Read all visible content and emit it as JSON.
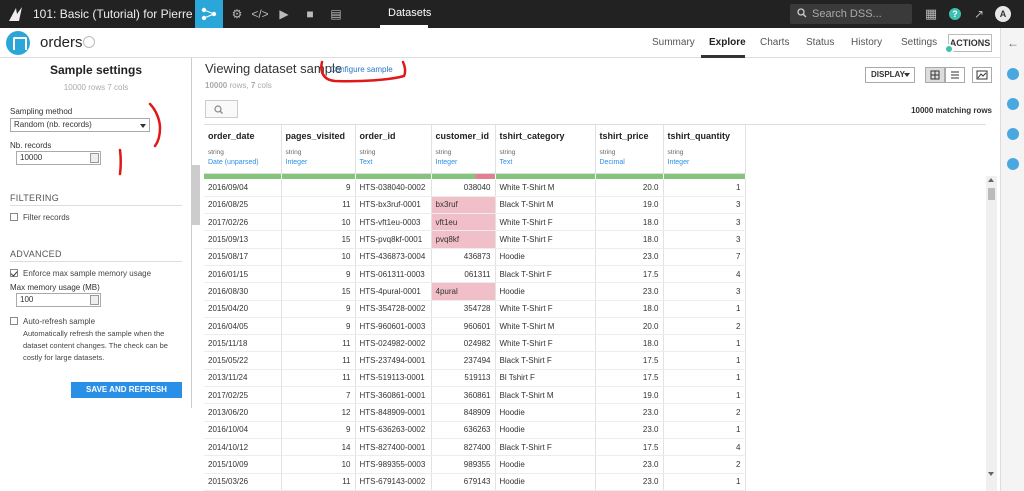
{
  "topbar": {
    "project": "101: Basic (Tutorial) for Pierre Ro...",
    "section": "Datasets",
    "search_placeholder": "Search DSS...",
    "help": "?",
    "avatar": "A"
  },
  "header": {
    "dataset_name": "orders",
    "tabs": [
      "Summary",
      "Explore",
      "Charts",
      "Status",
      "History",
      "Settings"
    ],
    "active_tab": "Explore",
    "actions_label": "ACTIONS"
  },
  "sample_settings": {
    "title": "Sample settings",
    "subtitle": "10000 rows 7 cols",
    "sampling_method_label": "Sampling method",
    "sampling_method_value": "Random (nb. records)",
    "nb_records_label": "Nb. records",
    "nb_records_value": "10000",
    "filtering_title": "FILTERING",
    "filter_records_label": "Filter records",
    "advanced_title": "ADVANCED",
    "enforce_label": "Enforce max sample memory usage",
    "max_memory_label": "Max memory usage (MB)",
    "max_memory_value": "100",
    "auto_refresh_label": "Auto-refresh sample",
    "auto_refresh_desc": "Automatically refresh the sample when the dataset content changes. The check can be costly for large datasets.",
    "save_button": "SAVE AND REFRESH SAMPLE"
  },
  "main": {
    "title": "Viewing dataset sample",
    "configure_link": "Configure sample",
    "rows_label": "10000",
    "rows_word": "rows,",
    "cols_label": "7",
    "cols_word": "cols",
    "display_label": "DISPLAY",
    "matching_rows": "10000 matching rows"
  },
  "table": {
    "columns": [
      {
        "name": "order_date",
        "storage": "string",
        "meaning": "Date (unparsed)"
      },
      {
        "name": "pages_visited",
        "storage": "string",
        "meaning": "Integer"
      },
      {
        "name": "order_id",
        "storage": "string",
        "meaning": "Text"
      },
      {
        "name": "customer_id",
        "storage": "string",
        "meaning": "Integer"
      },
      {
        "name": "tshirt_category",
        "storage": "string",
        "meaning": "Text"
      },
      {
        "name": "tshirt_price",
        "storage": "string",
        "meaning": "Decimal"
      },
      {
        "name": "tshirt_quantity",
        "storage": "string",
        "meaning": "Integer"
      }
    ],
    "rows": [
      [
        "2016/09/04",
        "9",
        "HTS-038040-0002",
        "038040",
        "White T-Shirt M",
        "20.0",
        "1"
      ],
      [
        "2016/08/25",
        "11",
        "HTS-bx3ruf-0001",
        "bx3ruf",
        "Black T-Shirt M",
        "19.0",
        "3"
      ],
      [
        "2017/02/26",
        "10",
        "HTS-vft1eu-0003",
        "vft1eu",
        "White T-Shirt F",
        "18.0",
        "3"
      ],
      [
        "2015/09/13",
        "15",
        "HTS-pvq8kf-0001",
        "pvq8kf",
        "White T-Shirt F",
        "18.0",
        "3"
      ],
      [
        "2015/08/17",
        "10",
        "HTS-436873-0004",
        "436873",
        "Hoodie",
        "23.0",
        "7"
      ],
      [
        "2016/01/15",
        "9",
        "HTS-061311-0003",
        "061311",
        "Black T-Shirt F",
        "17.5",
        "4"
      ],
      [
        "2016/08/30",
        "15",
        "HTS-4pural-0001",
        "4pural",
        "Hoodie",
        "23.0",
        "3"
      ],
      [
        "2015/04/20",
        "9",
        "HTS-354728-0002",
        "354728",
        "White T-Shirt F",
        "18.0",
        "1"
      ],
      [
        "2016/04/05",
        "9",
        "HTS-960601-0003",
        "960601",
        "White T-Shirt M",
        "20.0",
        "2"
      ],
      [
        "2015/11/18",
        "11",
        "HTS-024982-0002",
        "024982",
        "White T-Shirt F",
        "18.0",
        "1"
      ],
      [
        "2015/05/22",
        "11",
        "HTS-237494-0001",
        "237494",
        "Black T-Shirt F",
        "17.5",
        "1"
      ],
      [
        "2013/11/24",
        "11",
        "HTS-519113-0001",
        "519113",
        "Bl Tshirt F",
        "17.5",
        "1"
      ],
      [
        "2017/02/25",
        "7",
        "HTS-360861-0001",
        "360861",
        "Black T-Shirt M",
        "19.0",
        "1"
      ],
      [
        "2013/06/20",
        "12",
        "HTS-848909-0001",
        "848909",
        "Hoodie",
        "23.0",
        "2"
      ],
      [
        "2016/10/04",
        "9",
        "HTS-636263-0002",
        "636263",
        "Hoodie",
        "23.0",
        "1"
      ],
      [
        "2014/10/12",
        "14",
        "HTS-827400-0001",
        "827400",
        "Black T-Shirt F",
        "17.5",
        "4"
      ],
      [
        "2015/10/09",
        "10",
        "HTS-989355-0003",
        "989355",
        "Hoodie",
        "23.0",
        "2"
      ],
      [
        "2015/03/26",
        "11",
        "HTS-679143-0002",
        "679143",
        "Hoodie",
        "23.0",
        "1"
      ]
    ],
    "invalid_customer_ids": [
      "bx3ruf",
      "vft1eu",
      "pvq8kf",
      "4pural"
    ]
  },
  "colors": {
    "accent": "#2aa6d9",
    "valid": "#85c57b",
    "invalid": "#e27f92",
    "save_button": "#2a8fe6"
  }
}
